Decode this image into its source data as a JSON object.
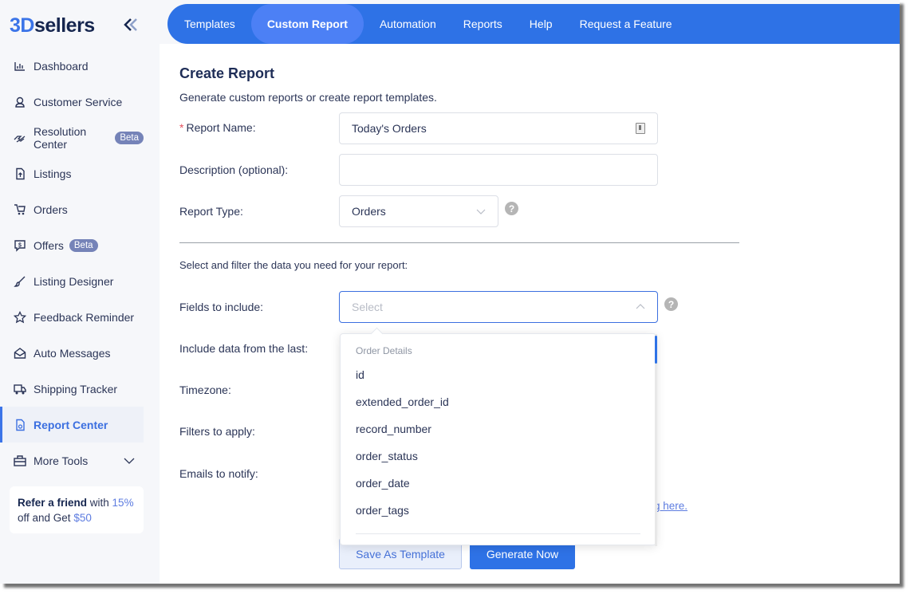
{
  "brand": {
    "part1": "3D",
    "part2": "sellers"
  },
  "sidebar": {
    "items": [
      {
        "label": "Dashboard",
        "icon": "bar-chart-icon"
      },
      {
        "label": "Customer Service",
        "icon": "headset-icon"
      },
      {
        "label": "Resolution Center",
        "icon": "handshake-icon",
        "badge": "Beta"
      },
      {
        "label": "Listings",
        "icon": "document-upload-icon"
      },
      {
        "label": "Orders",
        "icon": "cart-icon"
      },
      {
        "label": "Offers",
        "icon": "dollar-chat-icon",
        "badge": "Beta"
      },
      {
        "label": "Listing Designer",
        "icon": "brush-icon"
      },
      {
        "label": "Feedback Reminder",
        "icon": "star-icon"
      },
      {
        "label": "Auto Messages",
        "icon": "envelope-open-icon"
      },
      {
        "label": "Shipping Tracker",
        "icon": "truck-icon"
      },
      {
        "label": "Report Center",
        "icon": "report-file-icon",
        "active": true
      },
      {
        "label": "More Tools",
        "icon": "toolbox-icon"
      }
    ],
    "refer": {
      "bold": "Refer a friend",
      "text1": " with ",
      "pct": "15%",
      "text2": " off and Get ",
      "amount": "$50"
    }
  },
  "topnav": {
    "tabs": [
      "Templates",
      "Custom Report",
      "Automation",
      "Reports",
      "Help",
      "Request a Feature"
    ],
    "active_index": 1
  },
  "form": {
    "title": "Create Report",
    "subtitle": "Generate custom reports or create report templates.",
    "report_name_label": "Report Name:",
    "report_name_value": "Today's Orders",
    "description_label": "Description (optional):",
    "description_value": "",
    "report_type_label": "Report Type:",
    "report_type_value": "Orders",
    "section_label": "Select and filter the data you need for your report:",
    "fields_label": "Fields to include:",
    "fields_placeholder": "Select",
    "include_label": "Include data from the last:",
    "timezone_label": "Timezone:",
    "filters_label": "Filters to apply:",
    "emails_label": "Emails to notify:",
    "link_partial": "g here.",
    "save_template": "Save As Template",
    "generate_now": "Generate Now",
    "help_icon": "?"
  },
  "dropdown": {
    "group": "Order Details",
    "options": [
      "id",
      "extended_order_id",
      "record_number",
      "order_status",
      "order_date",
      "order_tags"
    ]
  }
}
